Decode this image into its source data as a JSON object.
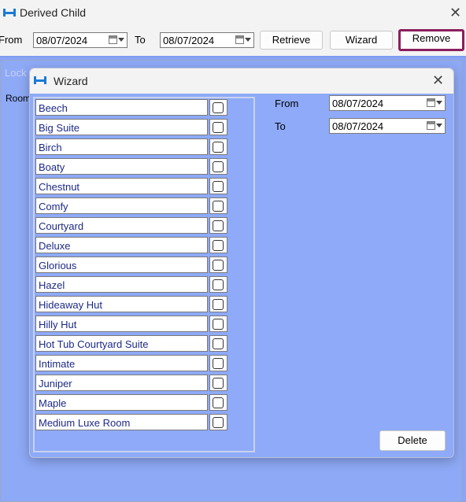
{
  "main_window": {
    "title": "Derived Child",
    "close": "✕"
  },
  "toolbar": {
    "from_label": "From",
    "from_date": "08/07/2024",
    "to_label": "To",
    "to_date": "08/07/2024",
    "retrieve_label": "Retrieve",
    "wizard_label": "Wizard",
    "remove_label": "Remove"
  },
  "background": {
    "lock_label": "Lock",
    "room_label": "Room"
  },
  "wizard": {
    "title": "Wizard",
    "close": "✕",
    "from_label": "From",
    "from_date": "08/07/2024",
    "to_label": "To",
    "to_date": "08/07/2024",
    "delete_label": "Delete",
    "rooms": [
      {
        "name": "Beech",
        "checked": false
      },
      {
        "name": "Big Suite",
        "checked": false
      },
      {
        "name": "Birch",
        "checked": false
      },
      {
        "name": "Boaty",
        "checked": false
      },
      {
        "name": "Chestnut",
        "checked": false
      },
      {
        "name": "Comfy",
        "checked": false
      },
      {
        "name": "Courtyard",
        "checked": false
      },
      {
        "name": "Deluxe",
        "checked": false
      },
      {
        "name": "Glorious",
        "checked": false
      },
      {
        "name": "Hazel",
        "checked": false
      },
      {
        "name": "Hideaway Hut",
        "checked": false
      },
      {
        "name": "Hilly Hut",
        "checked": false
      },
      {
        "name": "Hot Tub Courtyard Suite",
        "checked": false
      },
      {
        "name": "Intimate",
        "checked": false
      },
      {
        "name": "Juniper",
        "checked": false
      },
      {
        "name": "Maple",
        "checked": false
      },
      {
        "name": "Medium Luxe Room",
        "checked": false
      }
    ]
  },
  "colors": {
    "accent_border": "#8b1e5c",
    "panel_blue": "#8eaaf8",
    "room_text": "#1c2a86",
    "icon_blue": "#1a7ad6"
  }
}
